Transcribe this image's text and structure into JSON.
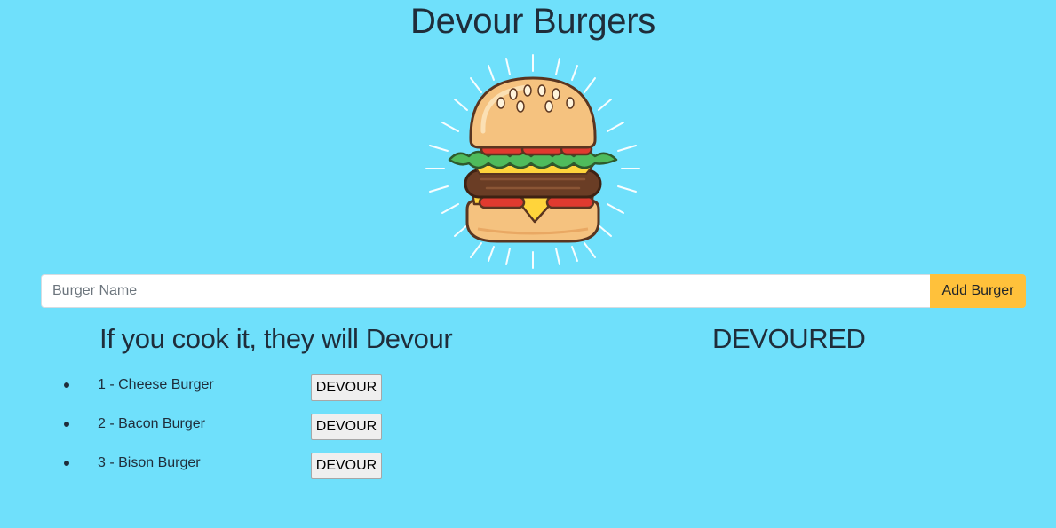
{
  "header": {
    "title": "Devour Burgers"
  },
  "hero": {
    "image": "burger-illustration"
  },
  "form": {
    "placeholder": "Burger Name",
    "value": "",
    "add_label": "Add Burger",
    "add_color": "#ffc13b"
  },
  "columns": {
    "left_heading": "If you cook it, they will Devour",
    "right_heading": "DEVOURED"
  },
  "burgers": [
    {
      "text": "1 - Cheese Burger",
      "button": "DEVOUR"
    },
    {
      "text": "2 - Bacon Burger",
      "button": "DEVOUR"
    },
    {
      "text": "3 - Bison Burger",
      "button": "DEVOUR"
    }
  ],
  "devoured": [],
  "colors": {
    "background": "#6fe0fb",
    "text": "#1f2d3a"
  }
}
